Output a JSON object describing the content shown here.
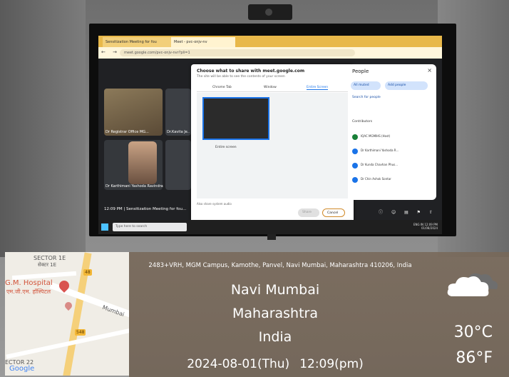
{
  "screen": {
    "browser_tab_1": "Sensitization Meeting for fou",
    "browser_tab_2": "Meet - pvc-onjv-nv",
    "url": "meet.google.com/pvc-onjv-nvr?pli=1",
    "dialog": {
      "title": "Choose what to share with meet.google.com",
      "subtitle": "The site will be able to see the contents of your screen",
      "tabs": [
        "Chrome Tab",
        "Window",
        "Entire Screen"
      ],
      "thumbnail_label": "Entire screen",
      "audio_note": "Also share system audio",
      "share_button": "Share",
      "cancel_button": "Cancel"
    },
    "tiles": [
      "Dr Registrar Office MG...",
      "Dr.Kavita Je...",
      "Dr Karthimani Yashoda Ravindra"
    ],
    "status": "12:09 PM | Sensitization Meeting for fou...",
    "people_panel": {
      "title": "People",
      "mute_all": "All muted",
      "add_people": "Add people",
      "search": "Search for people",
      "section": "Contributors",
      "participants": [
        "IQAC MGMIHS (Host)",
        "Dr Karthimani Yashoda R...",
        "Dr Kunda Chavhan Phus...",
        "Dr Chin Ashok Sontar"
      ]
    },
    "taskbar_search": "Type here to search",
    "tray_lang": "ENG",
    "tray_region": "IN",
    "tray_time": "12:09 PM",
    "tray_date": "01/08/2024"
  },
  "map": {
    "labels": [
      "SECTOR 1E",
      "सेक्टर 1E",
      "G.M. Hospital",
      "एम.जी.एम. हॉस्पिटल",
      "Mumbai",
      "ECTOR 22",
      "Google"
    ],
    "road_shields": [
      "48",
      "548"
    ]
  },
  "location": {
    "address": "2483+VRH, MGM Campus, Kamothe, Panvel, Navi Mumbai, Maharashtra 410206, India",
    "city": "Navi Mumbai",
    "state": "Maharashtra",
    "country": "India",
    "date": "2024-08-01(Thu)",
    "time": "12:09(pm)"
  },
  "weather": {
    "icon": "cloud-icon",
    "temp_c": "30°C",
    "temp_f": "86°F"
  }
}
